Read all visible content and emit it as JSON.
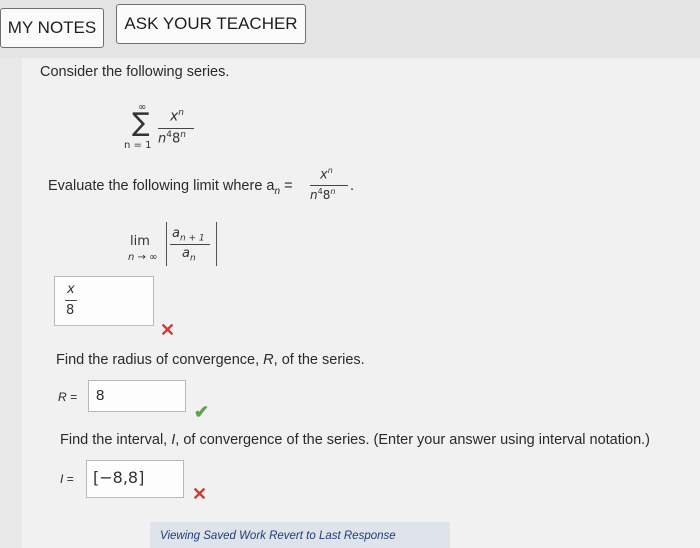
{
  "header": {
    "my_notes_label": "MY NOTES",
    "ask_teacher_label": "ASK YOUR TEACHER"
  },
  "question": {
    "intro": "Consider the following series.",
    "series": {
      "sigma": "∑",
      "upper": "∞",
      "lower": "n = 1",
      "numerator": "x",
      "numerator_exp": "n",
      "denominator_base1": "n",
      "denominator_exp1": "4",
      "denominator_base2": "8",
      "denominator_exp2": "n"
    },
    "limit_prompt_prefix": "Evaluate the following limit where a",
    "limit_prompt_sub": "n",
    "limit_prompt_eq": "=",
    "limit_prompt_period": ".",
    "limit": {
      "lim": "lim",
      "under": "n → ∞",
      "num_a": "a",
      "num_sub": "n + 1",
      "den_a": "a",
      "den_sub": "n"
    },
    "limit_answer": {
      "numerator": "x",
      "denominator": "8",
      "status": "incorrect"
    },
    "radius_prompt_1": "Find the radius of convergence, ",
    "radius_prompt_R": "R",
    "radius_prompt_2": ", of the series.",
    "radius_label": "R =",
    "radius_value": "8",
    "radius_status": "correct",
    "interval_prompt_1": "Find the interval, ",
    "interval_prompt_I": "I",
    "interval_prompt_2": ", of convergence of the series. (Enter your answer using interval notation.)",
    "interval_label": "I =",
    "interval_value": "[−8,8]",
    "interval_status": "incorrect",
    "incorrect_mark": "✕",
    "correct_mark": "✔"
  },
  "footer": {
    "link_text": "Viewing Saved Work Revert to Last Response"
  },
  "colors": {
    "correct": "#5ea34a",
    "incorrect": "#d43b2f"
  }
}
